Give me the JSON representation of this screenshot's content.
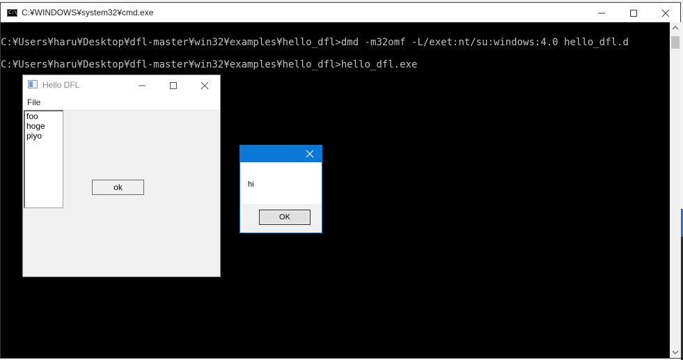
{
  "cmd_window": {
    "title": "C:¥WINDOWS¥system32¥cmd.exe",
    "icon_text": "C:\\",
    "lines": [
      "C:¥Users¥haru¥Desktop¥dfl-master¥win32¥examples¥hello_dfl>dmd -m32omf -L/exet:nt/su:windows:4.0 hello_dfl.d",
      "C:¥Users¥haru¥Desktop¥dfl-master¥win32¥examples¥hello_dfl>hello_dfl.exe"
    ],
    "text_color": "#c0c0c0",
    "background": "#000000"
  },
  "hello_window": {
    "title": "Hello DFL",
    "menu": [
      "File"
    ],
    "list_items": [
      "foo",
      "hoge",
      "piyo"
    ],
    "button_label": "ok"
  },
  "message_box": {
    "message": "hi",
    "button_label": "OK",
    "accent": "#0a78d7"
  }
}
